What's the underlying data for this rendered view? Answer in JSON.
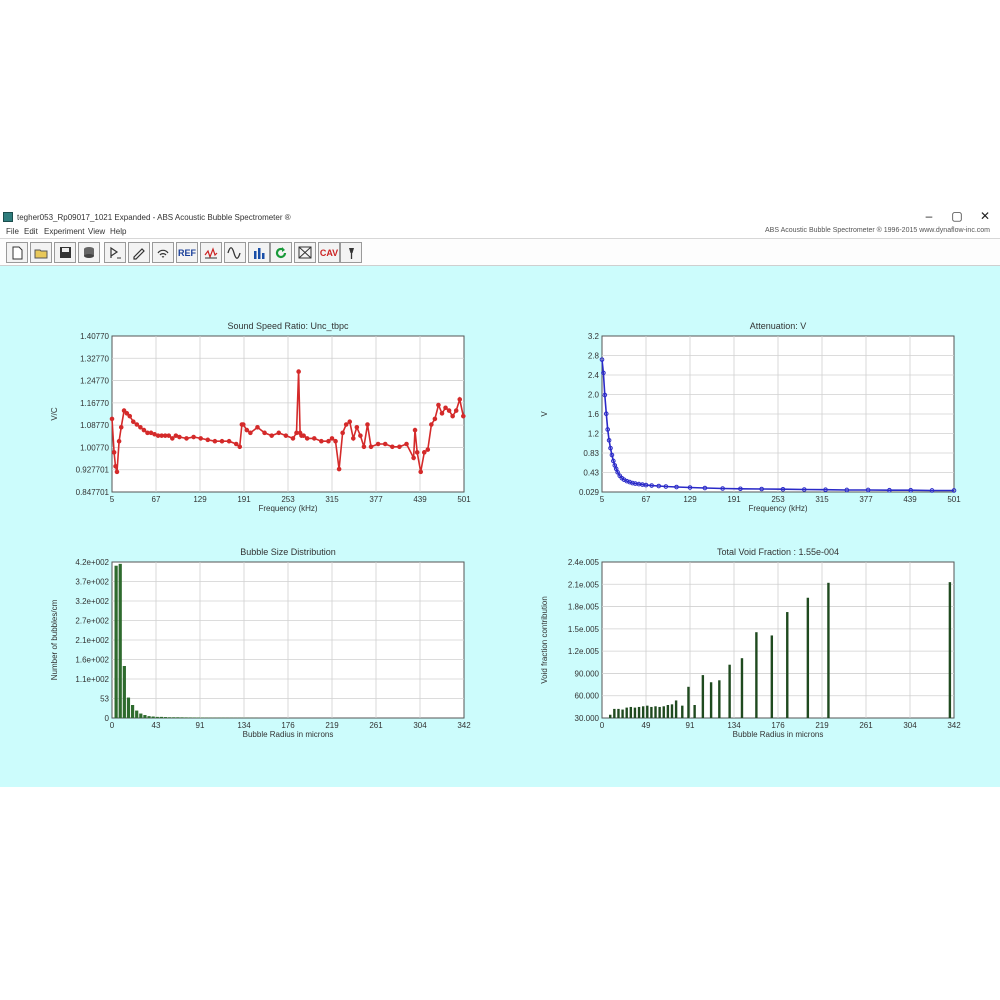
{
  "window": {
    "title": "tegher053_Rp09017_1021 Expanded - ABS Acoustic Bubble Spectrometer ®",
    "controls": [
      "–",
      "▢",
      "✕"
    ]
  },
  "menu": {
    "items": [
      "File",
      "Edit",
      "Experiment",
      "View",
      "Help"
    ],
    "right_info": "ABS Acoustic Bubble Spectrometer ® 1996-2015 www.dynaflow-inc.com"
  },
  "toolbar": {
    "buttons": [
      {
        "icon": "new-file-icon",
        "label": ""
      },
      {
        "icon": "open-folder-icon",
        "label": ""
      },
      {
        "icon": "save-icon",
        "label": ""
      },
      {
        "icon": "database-icon",
        "label": ""
      },
      {
        "icon": "calibration-icon",
        "label": ""
      },
      {
        "icon": "edit-settings-icon",
        "label": ""
      },
      {
        "icon": "signal-icon",
        "label": ""
      },
      {
        "icon": "reference-icon",
        "label": "REF"
      },
      {
        "icon": "waveform-icon",
        "label": ""
      },
      {
        "icon": "sine-wave-icon",
        "label": ""
      },
      {
        "icon": "bar-chart-icon",
        "label": ""
      },
      {
        "icon": "refresh-icon",
        "label": ""
      },
      {
        "icon": "cancel-icon",
        "label": ""
      },
      {
        "icon": "cav-icon",
        "label": "CAV"
      },
      {
        "icon": "probe-icon",
        "label": ""
      }
    ]
  },
  "chart_data": [
    {
      "type": "line",
      "title": "Sound Speed Ratio: Unc_tbpc",
      "xlabel": "Frequency (kHz)",
      "ylabel": "V/C",
      "xticks": [
        "5",
        "67",
        "129",
        "191",
        "253",
        "315",
        "377",
        "439",
        "501"
      ],
      "yticks": [
        "0.847701",
        "0.927701",
        "1.00770",
        "1.08770",
        "1.16770",
        "1.24770",
        "1.32770",
        "1.40770"
      ],
      "xlim": [
        5,
        501
      ],
      "ylim": [
        0.847701,
        1.4077
      ],
      "color": "#d42a2a",
      "x": [
        5,
        8,
        10,
        12,
        15,
        18,
        22,
        26,
        30,
        35,
        40,
        45,
        50,
        55,
        60,
        65,
        70,
        75,
        80,
        85,
        90,
        95,
        100,
        110,
        120,
        130,
        140,
        150,
        160,
        170,
        180,
        185,
        188,
        190,
        195,
        200,
        210,
        220,
        230,
        240,
        250,
        260,
        265,
        268,
        270,
        272,
        275,
        280,
        290,
        300,
        310,
        315,
        320,
        325,
        330,
        335,
        340,
        345,
        350,
        355,
        360,
        365,
        370,
        380,
        390,
        400,
        410,
        420,
        430,
        432,
        435,
        440,
        445,
        450,
        455,
        460,
        465,
        470,
        475,
        480,
        485,
        490,
        495,
        500
      ],
      "y": [
        1.11,
        0.99,
        0.94,
        0.92,
        1.03,
        1.08,
        1.14,
        1.13,
        1.12,
        1.1,
        1.09,
        1.08,
        1.07,
        1.06,
        1.06,
        1.055,
        1.05,
        1.05,
        1.05,
        1.05,
        1.04,
        1.05,
        1.045,
        1.04,
        1.045,
        1.04,
        1.035,
        1.03,
        1.03,
        1.03,
        1.02,
        1.01,
        1.09,
        1.09,
        1.07,
        1.06,
        1.08,
        1.06,
        1.05,
        1.06,
        1.05,
        1.04,
        1.06,
        1.28,
        1.06,
        1.05,
        1.05,
        1.04,
        1.04,
        1.03,
        1.03,
        1.04,
        1.03,
        0.93,
        1.06,
        1.09,
        1.1,
        1.04,
        1.08,
        1.05,
        1.01,
        1.09,
        1.01,
        1.02,
        1.02,
        1.01,
        1.01,
        1.02,
        0.97,
        1.07,
        0.99,
        0.92,
        0.99,
        1.0,
        1.09,
        1.11,
        1.16,
        1.13,
        1.15,
        1.14,
        1.12,
        1.14,
        1.18,
        1.12
      ]
    },
    {
      "type": "line",
      "title": "Attenuation: V",
      "xlabel": "Frequency (kHz)",
      "ylabel": "V",
      "xticks": [
        "5",
        "67",
        "129",
        "191",
        "253",
        "315",
        "377",
        "439",
        "501"
      ],
      "yticks": [
        "0.029",
        "0.43",
        "0.83",
        "1.2",
        "1.6",
        "2.0",
        "2.4",
        "2.8",
        "3.2"
      ],
      "xlim": [
        5,
        501
      ],
      "ylim": [
        0.029,
        3.2
      ],
      "color": "#2a2ac8",
      "x": [
        5,
        7,
        9,
        11,
        13,
        15,
        17,
        19,
        21,
        23,
        25,
        27,
        30,
        33,
        36,
        40,
        44,
        48,
        52,
        57,
        62,
        67,
        75,
        85,
        95,
        110,
        129,
        150,
        175,
        200,
        230,
        260,
        290,
        320,
        350,
        380,
        410,
        440,
        470,
        501
      ],
      "y": [
        2.72,
        2.45,
        2.0,
        1.62,
        1.3,
        1.08,
        0.92,
        0.78,
        0.66,
        0.57,
        0.5,
        0.43,
        0.36,
        0.31,
        0.28,
        0.25,
        0.23,
        0.21,
        0.2,
        0.19,
        0.18,
        0.17,
        0.16,
        0.15,
        0.14,
        0.13,
        0.12,
        0.11,
        0.1,
        0.095,
        0.09,
        0.085,
        0.08,
        0.075,
        0.07,
        0.07,
        0.065,
        0.065,
        0.06,
        0.06
      ]
    },
    {
      "type": "bar",
      "title": "Bubble Size Distribution",
      "xlabel": "Bubble Radius in microns",
      "ylabel": "Number of bubbles/cm",
      "xticks": [
        "0",
        "43",
        "91",
        "134",
        "176",
        "219",
        "261",
        "304",
        "342"
      ],
      "yticks": [
        "0",
        "53",
        "1.1e+002",
        "1.6e+002",
        "2.1e+002",
        "2.7e+002",
        "3.2e+002",
        "3.7e+002",
        "4.2e+002"
      ],
      "xlim": [
        0,
        342
      ],
      "ylim": [
        0,
        420
      ],
      "color": "#2e6b2e",
      "x": [
        4,
        8,
        12,
        16,
        20,
        24,
        28,
        32,
        36,
        40,
        44,
        48,
        52,
        56,
        60,
        64,
        68,
        72,
        76,
        80,
        84,
        88,
        92,
        96,
        100,
        104,
        108,
        112,
        116,
        120,
        124,
        128,
        132,
        136,
        140
      ],
      "values": [
        410,
        415,
        140,
        55,
        35,
        20,
        12,
        8,
        5,
        4,
        3,
        3,
        2.5,
        2,
        2,
        2,
        1.8,
        1.6,
        1.5,
        1.4,
        1.3,
        1.2,
        1.1,
        1,
        1,
        0.9,
        0.9,
        0.8,
        0.8,
        0.7,
        0.7,
        0.6,
        0.6,
        0.5,
        0.5
      ]
    },
    {
      "type": "bar",
      "title": "Total Void Fraction : 1.55e-004",
      "xlabel": "Bubble Radius in microns",
      "ylabel": "Void fraction contribution",
      "xticks": [
        "0",
        "49",
        "91",
        "134",
        "176",
        "219",
        "261",
        "304",
        "342"
      ],
      "yticks": [
        "30.000",
        "60.000",
        "90.000",
        "1.2e.005",
        "1.5e.005",
        "1.8e.005",
        "2.1e.005",
        "2.4e.005"
      ],
      "xlim": [
        0,
        342
      ],
      "ylim": [
        0,
        240000
      ],
      "color": "#1f4a1f",
      "x": [
        8,
        12,
        16,
        20,
        24,
        28,
        32,
        36,
        40,
        44,
        48,
        52,
        56,
        60,
        64,
        68,
        72,
        78,
        84,
        90,
        98,
        106,
        114,
        124,
        136,
        150,
        165,
        180,
        200,
        220,
        245,
        270,
        300,
        338
      ],
      "values": [
        5000,
        14000,
        14000,
        13000,
        16000,
        17000,
        16000,
        17000,
        18000,
        19000,
        17000,
        18000,
        17000,
        18000,
        20000,
        21000,
        27000,
        19000,
        48000,
        20000,
        66000,
        55000,
        58000,
        82000,
        92000,
        132000,
        127000,
        163000,
        185000,
        208000,
        0,
        0,
        0,
        209000
      ]
    }
  ]
}
